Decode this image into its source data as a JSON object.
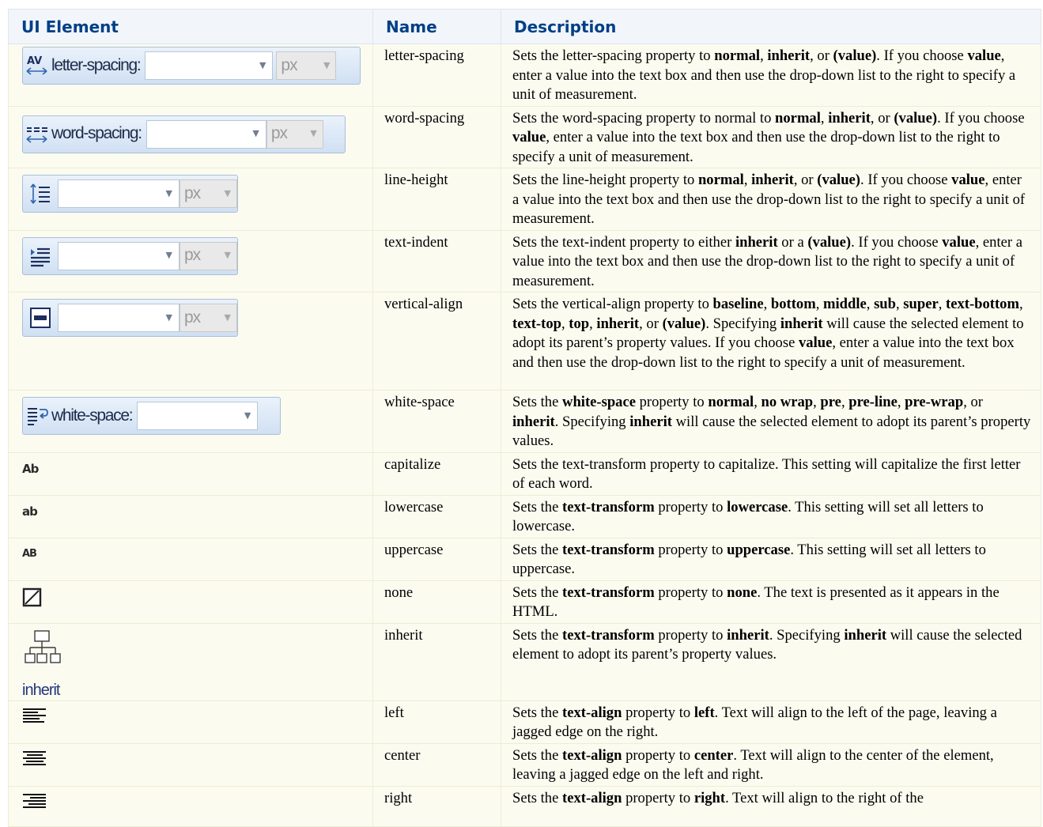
{
  "headers": {
    "ui_element": "UI Element",
    "name": "Name",
    "description": "Description"
  },
  "widgets": {
    "letter_spacing_label": "letter-spacing:",
    "word_spacing_label": "word-spacing:",
    "white_space_label": "white-space:",
    "unit": "px",
    "inherit_label": "inherit",
    "glyph_capitalize": "Ab",
    "glyph_lowercase": "ab",
    "glyph_uppercase": "AB"
  },
  "rows": [
    {
      "name": "letter-spacing",
      "description": [
        {
          "t": "Sets the letter-spacing property to "
        },
        {
          "t": "normal",
          "b": true
        },
        {
          "t": ", "
        },
        {
          "t": "inherit",
          "b": true
        },
        {
          "t": ", or "
        },
        {
          "t": "(value)",
          "b": true
        },
        {
          "t": ". If you choose "
        },
        {
          "t": "value",
          "b": true
        },
        {
          "t": ", enter a value into the text box and then use the drop-down list to the right to specify a unit of measurement."
        }
      ]
    },
    {
      "name": "word-spacing",
      "description": [
        {
          "t": "Sets the word-spacing property to normal to "
        },
        {
          "t": "normal",
          "b": true
        },
        {
          "t": ", "
        },
        {
          "t": "inherit",
          "b": true
        },
        {
          "t": ", or "
        },
        {
          "t": "(value)",
          "b": true
        },
        {
          "t": ". If you choose "
        },
        {
          "t": "value",
          "b": true
        },
        {
          "t": ", enter a value into the text box and then use the drop-down list to the right to specify a unit of measurement."
        }
      ]
    },
    {
      "name": "line-height",
      "description": [
        {
          "t": "Sets the line-height property to "
        },
        {
          "t": "normal",
          "b": true
        },
        {
          "t": ", "
        },
        {
          "t": "inherit",
          "b": true
        },
        {
          "t": ", or "
        },
        {
          "t": "(value)",
          "b": true
        },
        {
          "t": ". If you choose "
        },
        {
          "t": "value",
          "b": true
        },
        {
          "t": ", enter a value into the text box and then use the drop-down list to the right to specify a unit of measurement."
        }
      ]
    },
    {
      "name": "text-indent",
      "description": [
        {
          "t": "Sets the text-indent property to either "
        },
        {
          "t": "inherit",
          "b": true
        },
        {
          "t": " or a "
        },
        {
          "t": "(value)",
          "b": true
        },
        {
          "t": ". If you choose "
        },
        {
          "t": "value",
          "b": true
        },
        {
          "t": ", enter a value into the text box and then use the drop-down list to the right to specify a unit of measurement."
        }
      ]
    },
    {
      "name": "vertical-align",
      "description": [
        {
          "t": "Sets the vertical-align property to "
        },
        {
          "t": "baseline",
          "b": true
        },
        {
          "t": ", "
        },
        {
          "t": "bottom",
          "b": true
        },
        {
          "t": ", "
        },
        {
          "t": "middle",
          "b": true
        },
        {
          "t": ", "
        },
        {
          "t": "sub",
          "b": true
        },
        {
          "t": ", "
        },
        {
          "t": "super",
          "b": true
        },
        {
          "t": ", "
        },
        {
          "t": "text-bottom",
          "b": true
        },
        {
          "t": ", "
        },
        {
          "t": "text-top",
          "b": true
        },
        {
          "t": ", "
        },
        {
          "t": "top",
          "b": true
        },
        {
          "t": ", "
        },
        {
          "t": "inherit",
          "b": true
        },
        {
          "t": ", or "
        },
        {
          "t": "(value)",
          "b": true
        },
        {
          "t": ". Specifying "
        },
        {
          "t": "inherit",
          "b": true
        },
        {
          "t": " will cause the selected element to adopt its parent’s property values. If you choose "
        },
        {
          "t": "value",
          "b": true
        },
        {
          "t": ", enter a value into the text box and then use the drop-down list to the right to specify a unit of measurement."
        }
      ]
    },
    {
      "name": "white-space",
      "description": [
        {
          "t": "Sets the "
        },
        {
          "t": "white-space",
          "b": true
        },
        {
          "t": " property to "
        },
        {
          "t": "normal",
          "b": true
        },
        {
          "t": ", "
        },
        {
          "t": "no wrap",
          "b": true
        },
        {
          "t": ", "
        },
        {
          "t": "pre",
          "b": true
        },
        {
          "t": ", "
        },
        {
          "t": "pre-line",
          "b": true
        },
        {
          "t": ", "
        },
        {
          "t": "pre-wrap",
          "b": true
        },
        {
          "t": ", or "
        },
        {
          "t": "inherit",
          "b": true
        },
        {
          "t": ". Specifying "
        },
        {
          "t": "inherit",
          "b": true
        },
        {
          "t": " will cause the selected element to adopt its parent’s property values."
        }
      ]
    },
    {
      "name": "capitalize",
      "description": [
        {
          "t": "Sets the text-transform property to capitalize. This setting will capitalize the first letter of each word."
        }
      ]
    },
    {
      "name": "lowercase",
      "description": [
        {
          "t": "Sets the "
        },
        {
          "t": "text-transform",
          "b": true
        },
        {
          "t": " property to "
        },
        {
          "t": "lowercase",
          "b": true
        },
        {
          "t": ". This setting will set all letters to lowercase."
        }
      ]
    },
    {
      "name": "uppercase",
      "description": [
        {
          "t": "Sets the "
        },
        {
          "t": "text-transform",
          "b": true
        },
        {
          "t": " property to "
        },
        {
          "t": "uppercase",
          "b": true
        },
        {
          "t": ". This setting will set all letters to uppercase."
        }
      ]
    },
    {
      "name": "none",
      "description": [
        {
          "t": "Sets the "
        },
        {
          "t": "text-transform",
          "b": true
        },
        {
          "t": " property to "
        },
        {
          "t": "none",
          "b": true
        },
        {
          "t": ". The text is presented as it appears in the HTML."
        }
      ]
    },
    {
      "name": "inherit",
      "description": [
        {
          "t": "Sets the "
        },
        {
          "t": "text-transform",
          "b": true
        },
        {
          "t": " property to "
        },
        {
          "t": "inherit",
          "b": true
        },
        {
          "t": ". Specifying "
        },
        {
          "t": "inherit",
          "b": true
        },
        {
          "t": " will cause the selected element to adopt its parent’s property values."
        }
      ]
    },
    {
      "name": "left",
      "description": [
        {
          "t": "Sets the "
        },
        {
          "t": "text-align",
          "b": true
        },
        {
          "t": " property to "
        },
        {
          "t": "left",
          "b": true
        },
        {
          "t": ". Text will align to the left of the page, leaving a jagged edge on the right."
        }
      ]
    },
    {
      "name": "center",
      "description": [
        {
          "t": "Sets the "
        },
        {
          "t": "text-align",
          "b": true
        },
        {
          "t": " property to "
        },
        {
          "t": "center",
          "b": true
        },
        {
          "t": ". Text will align to the center of the element, leaving a jagged edge on the left and right."
        }
      ]
    },
    {
      "name": "right",
      "description": [
        {
          "t": "Sets the "
        },
        {
          "t": "text-align",
          "b": true
        },
        {
          "t": " property to "
        },
        {
          "t": "right",
          "b": true
        },
        {
          "t": ". Text will align to the right of the"
        }
      ]
    }
  ]
}
